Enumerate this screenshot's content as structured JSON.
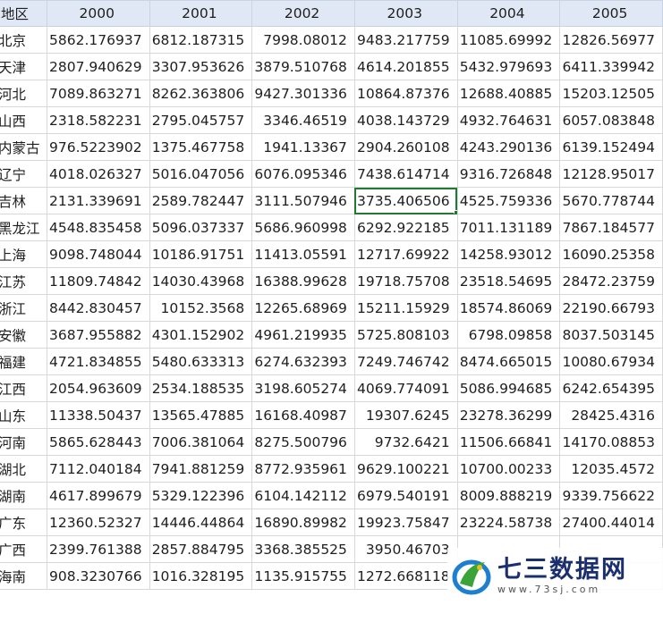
{
  "header": {
    "corner": "地区",
    "years": [
      "2000",
      "2001",
      "2002",
      "2003",
      "2004",
      "2005"
    ]
  },
  "rows": [
    {
      "region": "北京",
      "values": [
        "5862.176937",
        "6812.187315",
        "7998.08012",
        "9483.217759",
        "11085.69992",
        "12826.56977"
      ]
    },
    {
      "region": "天津",
      "values": [
        "2807.940629",
        "3307.953626",
        "3879.510768",
        "4614.201855",
        "5432.979693",
        "6411.339942"
      ]
    },
    {
      "region": "河北",
      "values": [
        "7089.863271",
        "8262.363806",
        "9427.301336",
        "10864.87376",
        "12688.40885",
        "15203.12505"
      ]
    },
    {
      "region": "山西",
      "values": [
        "2318.582231",
        "2795.045757",
        "3346.46519",
        "4038.143729",
        "4932.764631",
        "6057.083848"
      ]
    },
    {
      "region": "内蒙古",
      "values": [
        "976.5223902",
        "1375.467758",
        "1941.13367",
        "2904.260108",
        "4243.290136",
        "6139.152494"
      ]
    },
    {
      "region": "辽宁",
      "values": [
        "4018.026327",
        "5016.047056",
        "6076.095346",
        "7438.614714",
        "9316.726848",
        "12128.95017"
      ]
    },
    {
      "region": "吉林",
      "values": [
        "2131.339691",
        "2589.782447",
        "3111.507946",
        "3735.406506",
        "4525.759336",
        "5670.778744"
      ]
    },
    {
      "region": "黑龙江",
      "values": [
        "4548.835458",
        "5096.037337",
        "5686.960998",
        "6292.922185",
        "7011.131189",
        "7867.184577"
      ]
    },
    {
      "region": "上海",
      "values": [
        "9098.748044",
        "10186.91751",
        "11413.05591",
        "12717.69922",
        "14258.93012",
        "16090.25358"
      ]
    },
    {
      "region": "江苏",
      "values": [
        "11809.74842",
        "14030.43968",
        "16388.99628",
        "19718.75708",
        "23518.54695",
        "28472.23759"
      ]
    },
    {
      "region": "浙江",
      "values": [
        "8442.830457",
        "10152.3568",
        "12265.68969",
        "15211.15929",
        "18574.86069",
        "22190.66793"
      ]
    },
    {
      "region": "安徽",
      "values": [
        "3687.955882",
        "4301.152902",
        "4961.219935",
        "5725.808103",
        "6798.09858",
        "8037.503145"
      ]
    },
    {
      "region": "福建",
      "values": [
        "4721.834855",
        "5480.633313",
        "6274.632393",
        "7249.746742",
        "8474.665015",
        "10080.67934"
      ]
    },
    {
      "region": "江西",
      "values": [
        "2054.963609",
        "2534.188535",
        "3198.605274",
        "4069.774091",
        "5086.994685",
        "6242.654395"
      ]
    },
    {
      "region": "山东",
      "values": [
        "11338.50437",
        "13565.47885",
        "16168.40987",
        "19307.6245",
        "23278.36299",
        "28425.4316"
      ]
    },
    {
      "region": "河南",
      "values": [
        "5865.628443",
        "7006.381064",
        "8275.500796",
        "9732.6421",
        "11506.66841",
        "14170.08853"
      ]
    },
    {
      "region": "湖北",
      "values": [
        "7112.040184",
        "7941.881259",
        "8772.935961",
        "9629.100221",
        "10700.00233",
        "12035.4572"
      ]
    },
    {
      "region": "湖南",
      "values": [
        "4617.899679",
        "5329.122396",
        "6104.142112",
        "6979.540191",
        "8009.888219",
        "9339.756622"
      ]
    },
    {
      "region": "广东",
      "values": [
        "12360.52327",
        "14446.44864",
        "16890.89982",
        "19923.75847",
        "23224.58738",
        "27400.44014"
      ]
    },
    {
      "region": "广西",
      "values": [
        "2399.761388",
        "2857.884795",
        "3368.385525",
        "3950.46703",
        "",
        ""
      ]
    },
    {
      "region": "海南",
      "values": [
        "908.3230766",
        "1016.328195",
        "1135.915755",
        "1272.668118",
        "",
        ""
      ]
    }
  ],
  "selected": {
    "row": 6,
    "col": 3
  },
  "watermark": {
    "brand": "七三数据网",
    "url": "www.73sj.com"
  },
  "colors": {
    "header_bg": "#dfe8f4",
    "selection": "#1f7a34",
    "grid": "#d8d8d8"
  }
}
